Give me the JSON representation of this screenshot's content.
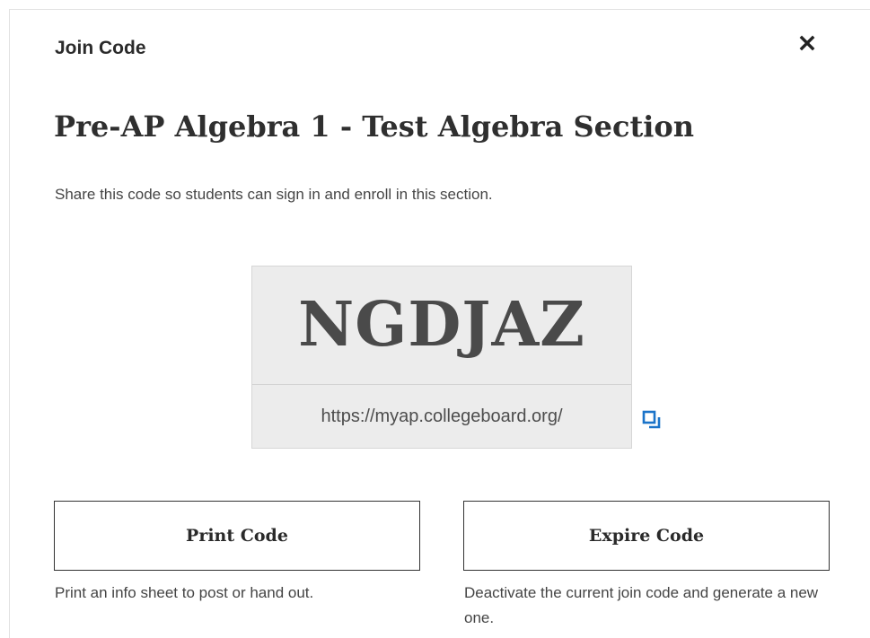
{
  "dialog": {
    "label": "Join Code",
    "close_icon": "close-icon"
  },
  "section": {
    "title": "Pre-AP Algebra 1 - Test Algebra Section",
    "description": "Share this code so students can sign in and enroll in this section."
  },
  "code": {
    "value": "NGDJAZ",
    "url": "https://myap.collegeboard.org/",
    "copy_icon": "copy-icon"
  },
  "actions": {
    "print_label": "Print Code",
    "print_help": "Print an info sheet to post or hand out.",
    "expire_label": "Expire Code",
    "expire_help": "Deactivate the current join code and generate a new one."
  },
  "colors": {
    "accent": "#1a73c9",
    "code_bg": "#ececec"
  }
}
